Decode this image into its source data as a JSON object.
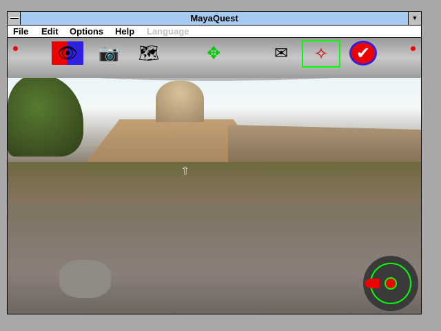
{
  "window": {
    "title": "MayaQuest"
  },
  "menu": [
    {
      "label": "File"
    },
    {
      "label": "Edit"
    },
    {
      "label": "Options"
    },
    {
      "label": "Help"
    },
    {
      "label": "Language",
      "disabled": true
    }
  ],
  "toolbar": [
    {
      "icon": "look-help-icon",
      "glyph": "👁"
    },
    {
      "icon": "camera-icon",
      "glyph": "📷"
    },
    {
      "icon": "map-icon",
      "glyph": "🗺"
    },
    {
      "icon": "navigation-arrows-icon",
      "glyph": "✥"
    },
    {
      "icon": "mail-icon",
      "glyph": "✉"
    },
    {
      "icon": "compass-icon",
      "glyph": "✧"
    },
    {
      "icon": "checkmark-icon",
      "glyph": "✔"
    }
  ],
  "colors": {
    "titlebar": "#a6caf0",
    "highlight": "#00ff00"
  }
}
